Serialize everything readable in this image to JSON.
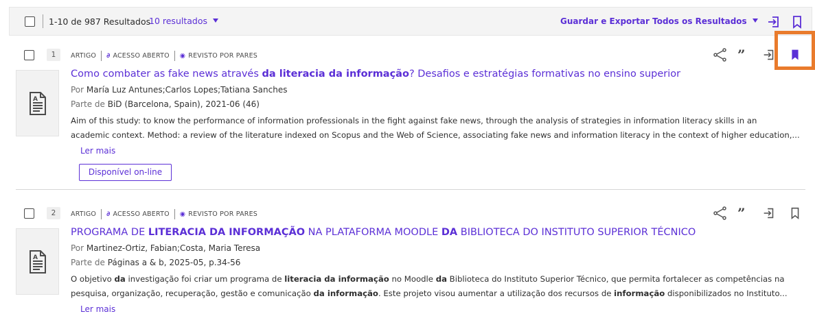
{
  "toolbar": {
    "result_count": "1-10 de 987 Resultados",
    "per_page": "10 resultados",
    "export_label": "Guardar e Exportar Todos os Resultados",
    "icons": [
      "export-icon",
      "bookmark-icon"
    ]
  },
  "records": [
    {
      "number": "1",
      "type": "ARTIGO",
      "open_access": "ACESSO ABERTO",
      "peer_reviewed": "REVISTO POR PARES",
      "title_pre": "Como combater as fake news através ",
      "title_bold": "da literacia da informação",
      "title_post": "? Desafios e estratégias formativas no ensino superior",
      "by_prefix": "Por",
      "authors": "María Luz Antunes;Carlos Lopes;Tatiana Sanches",
      "part_prefix": "Parte de",
      "source": "BiD (Barcelona, Spain), 2021-06 (46)",
      "abstract_line1": "Aim of this study: to know the performance of information professionals in the fight against fake news, through the analysis of strategies in information literacy skills in an",
      "abstract_line2": "academic context. Method: a review of the literature indexed on Scopus and the Web of Science, associating fake news and information literacy in the context of higher education,...",
      "read_more": "Ler mais",
      "availability": "Disponível on-line",
      "bookmarked": true
    },
    {
      "number": "2",
      "type": "ARTIGO",
      "open_access": "ACESSO ABERTO",
      "peer_reviewed": "REVISTO POR PARES",
      "title_a": "PROGRAMA DE ",
      "title_b": "LITERACIA DA INFORMAÇÃO",
      "title_c": " NA PLATAFORMA MOODLE ",
      "title_d": "DA",
      "title_e": " BIBLIOTECA DO INSTITUTO SUPERIOR TÉCNICO",
      "by_prefix": "Por",
      "authors": "Martinez-Ortiz, Fabian;Costa, Maria Teresa",
      "part_prefix": "Parte de",
      "source": "Páginas a & b, 2025-05, p.34-56",
      "abs1_a": "O objetivo ",
      "abs1_b": "da",
      "abs1_c": " investigação foi criar um programa de ",
      "abs1_d": "literacia da informação",
      "abs1_e": " no Moodle ",
      "abs1_f": "da",
      "abs1_g": " Biblioteca do Instituto Superior Técnico, que permita fortalecer as competências na",
      "abs2_a": "pesquisa, organização, recuperação, gestão e comunicação ",
      "abs2_b": "da informação",
      "abs2_c": ". Este projeto visou aumentar a utilização dos recursos de ",
      "abs2_d": "informação",
      "abs2_e": " disponibilizados no Instituto...",
      "read_more": "Ler mais",
      "bookmarked": false
    }
  ],
  "colors": {
    "accent": "#5b2fd6",
    "highlight": "#e97b2c"
  },
  "icons": [
    "share-icon",
    "quote-icon",
    "export-icon",
    "bookmark-icon",
    "document-icon",
    "open-access-icon",
    "peer-review-icon"
  ]
}
